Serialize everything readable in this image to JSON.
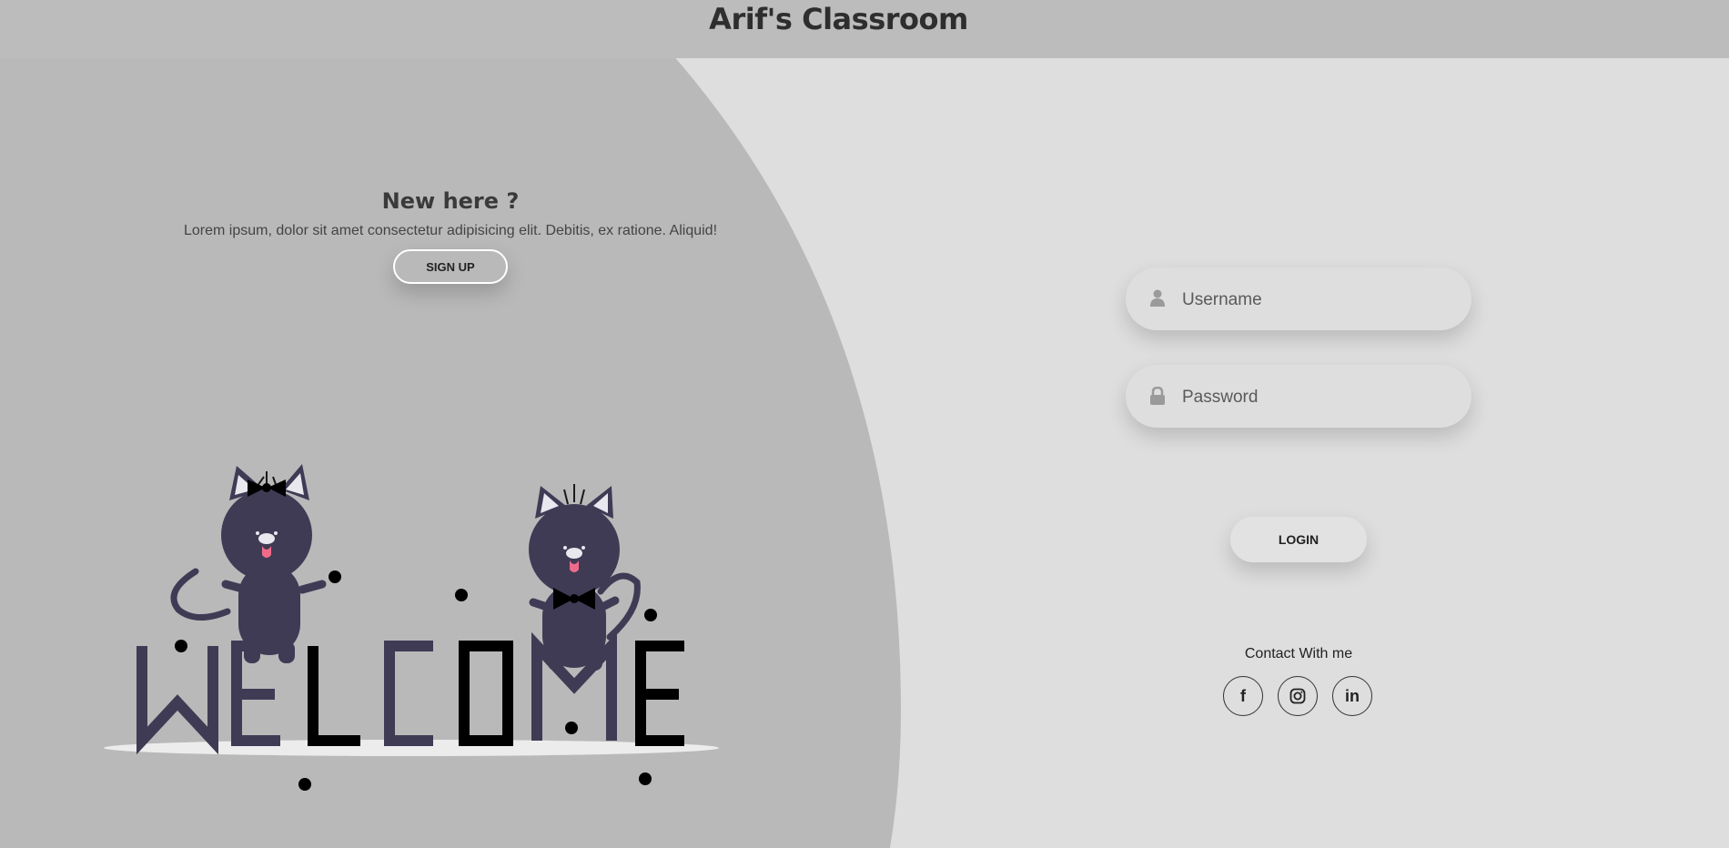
{
  "header": {
    "title": "Arif's Classroom"
  },
  "signup_panel": {
    "heading": "New here ?",
    "description": "Lorem ipsum, dolor sit amet consectetur adipisicing elit. Debitis, ex ratione. Aliquid!",
    "button_label": "SIGN UP",
    "illustration_text": "WELCOME"
  },
  "login_form": {
    "username_placeholder": "Username",
    "password_placeholder": "Password",
    "login_label": "LOGIN"
  },
  "contact": {
    "label": "Contact With me",
    "socials": [
      {
        "name": "facebook",
        "icon": "facebook-icon",
        "glyph": "f"
      },
      {
        "name": "instagram",
        "icon": "instagram-icon",
        "glyph": ""
      },
      {
        "name": "linkedin",
        "icon": "linkedin-icon",
        "glyph": "in"
      }
    ]
  },
  "colors": {
    "topbar": "#bcbcbc",
    "left_panel": "#b9b9b9",
    "right_panel": "#dedede",
    "cat": "#3f3b55",
    "text_dark": "#2e2e2e"
  }
}
